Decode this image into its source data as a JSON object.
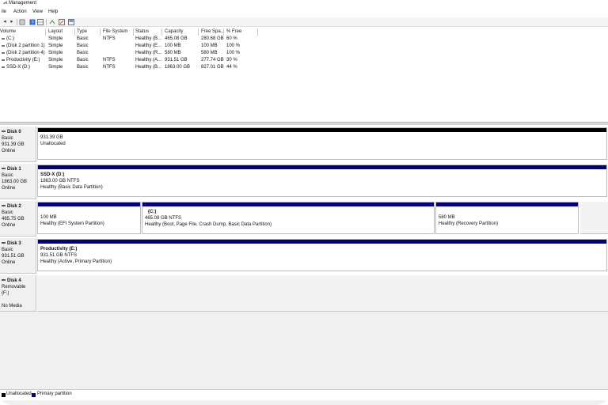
{
  "window": {
    "title": "isk Management"
  },
  "menu": [
    "ile",
    "Action",
    "View",
    "Help"
  ],
  "toolbar": {
    "icons": [
      "back-arrow-icon",
      "forward-arrow-icon",
      "properties-icon",
      "help-icon",
      "list-view-icon",
      "rescan-icon",
      "edit-icon",
      "disk-view-icon"
    ]
  },
  "volumes": {
    "headers": [
      "Volume",
      "Layout",
      "Type",
      "File System",
      "Status",
      "Capacity",
      "Free Spa...",
      "% Free"
    ],
    "rows": [
      [
        "(C:)",
        "Simple",
        "Basic",
        "NTFS",
        "Healthy (B...",
        "465.08 GB",
        "280.68 GB",
        "60 %"
      ],
      [
        "(Disk 2 partition 1)",
        "Simple",
        "Basic",
        "",
        "Healthy (E...",
        "100 MB",
        "100 MB",
        "100 %"
      ],
      [
        "(Disk 2 partition 4)",
        "Simple",
        "Basic",
        "",
        "Healthy (R...",
        "580 MB",
        "580 MB",
        "100 %"
      ],
      [
        "Productivity (E:)",
        "Simple",
        "Basic",
        "NTFS",
        "Healthy (A...",
        "931.51 GB",
        "277.74 GB",
        "30 %"
      ],
      [
        "SSD-X (D:)",
        "Simple",
        "Basic",
        "NTFS",
        "Healthy (B...",
        "1863.00 GB",
        "827.01 GB",
        "44 %"
      ]
    ]
  },
  "disks": [
    {
      "name": "Disk 0",
      "type": "Basic",
      "size": "931.39 GB",
      "state": "Online",
      "partitions": [
        {
          "bar_color": "#000000",
          "name": "",
          "size": "931.39 GB",
          "status": "Unallocated"
        }
      ]
    },
    {
      "name": "Disk 1",
      "type": "Basic",
      "size": "1863.00 GB",
      "state": "Online",
      "partitions": [
        {
          "bar_color": "#00007f",
          "name": "SSD-X  (D:)",
          "size": "1863.00 GB NTFS",
          "status": "Healthy (Basic Data Partition)"
        }
      ]
    },
    {
      "name": "Disk 2",
      "type": "Basic",
      "size": "465.75 GB",
      "state": "Online",
      "partitions": [
        {
          "bar_color": "#00007f",
          "name": "",
          "size": "100 MB",
          "status": "Healthy (EFI System Partition)"
        },
        {
          "bar_color": "#00007f",
          "name": "(C:)",
          "size": "465.08 GB NTFS",
          "status": "Healthy (Boot, Page File, Crash Dump, Basic Data Partition)"
        },
        {
          "bar_color": "#00007f",
          "name": "",
          "size": "580 MB",
          "status": "Healthy (Recovery Partition)"
        }
      ]
    },
    {
      "name": "Disk 3",
      "type": "Basic",
      "size": "931.51 GB",
      "state": "Online",
      "partitions": [
        {
          "bar_color": "#00007f",
          "name": "Productivity  (E:)",
          "size": "931.51 GB NTFS",
          "status": "Healthy (Active, Primary Partition)"
        }
      ]
    },
    {
      "name": "Disk 4",
      "type": "Removable (F:)",
      "size": "",
      "state": "No Media",
      "partitions": []
    }
  ],
  "legend": [
    {
      "label": "Unallocated",
      "color": "#000000"
    },
    {
      "label": "Primary partition",
      "color": "#00007f"
    }
  ]
}
